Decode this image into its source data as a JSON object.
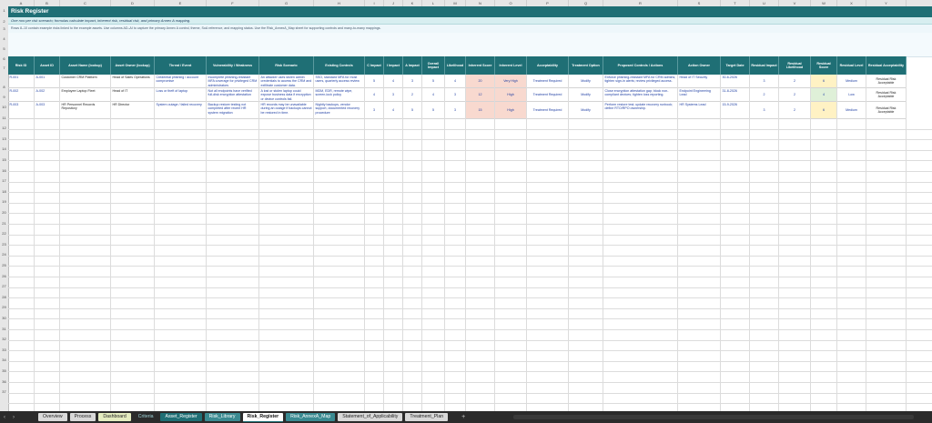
{
  "title": "Risk Register",
  "subtitle": "One row per risk scenario; formulas calculate impact, inherent risk, residual risk, and primary Annex A mapping.",
  "note": "Rows 8–10 contain example risks linked to the example assets. Use columns AD–AI to capture the primary Annex A control, theme, SoA reference, and mapping status. Use the Risk_AnnexA_Map sheet for supporting controls and many-to-many mappings.",
  "columns_letters": [
    "A",
    "B",
    "C",
    "D",
    "E",
    "F",
    "G",
    "H",
    "I",
    "J",
    "K",
    "L",
    "M",
    "N",
    "O",
    "P",
    "Q",
    "R",
    "S",
    "T",
    "U",
    "V",
    "W",
    "X",
    "Y"
  ],
  "headers": [
    "Risk ID",
    "Asset ID",
    "Asset Name (lookup)",
    "Asset Owner (lookup)",
    "Threat / Event",
    "Vulnerability / Weakness",
    "Risk Scenario",
    "Existing Controls",
    "C Impact",
    "I Impact",
    "A Impact",
    "Overall Impact",
    "Likelihood",
    "Inherent Score",
    "Inherent Level",
    "Acceptability",
    "Treatment Option",
    "Proposed Controls / Actions",
    "Action Owner",
    "Target Date",
    "Residual Impact",
    "Residual Likelihood",
    "Residual Score",
    "Residual Level",
    "Residual Acceptability"
  ],
  "rows": [
    [
      "R-001",
      "A-001",
      "Customer CRM Platform",
      "Head of Sales Operations",
      "Credential phishing / account compromise",
      "Incomplete phishing-resistant MFA coverage for privileged CRM administrators",
      "An attacker uses stolen admin credentials to access the CRM and exfiltrate customer data.",
      "SSO, standard MFA for most users, quarterly access review",
      "5",
      "4",
      "3",
      "5",
      "4",
      "20",
      "Very High",
      "Treatment Required",
      "Modify",
      "Enforce phishing-resistant MFA for CRM admins; tighten sign-in alerts; review privileged access.",
      "Head of IT Security",
      "30-6-2026",
      "3",
      "2",
      "6",
      "Medium",
      "Residual Risk Acceptable"
    ],
    [
      "R-002",
      "A-002",
      "Employee Laptop Fleet",
      "Head of IT",
      "Loss or theft of laptop",
      "Not all endpoints have verified full-disk encryption attestation",
      "A lost or stolen laptop could expose business data if encryption or device controls fail.",
      "MDM, EDR, remote wipe, screen-lock policy",
      "4",
      "3",
      "2",
      "4",
      "3",
      "12",
      "High",
      "Treatment Required",
      "Modify",
      "Close encryption attestation gap; block non-compliant devices; tighten loss reporting.",
      "Endpoint Engineering Lead",
      "31-8-2026",
      "2",
      "2",
      "4",
      "Low",
      "Residual Risk Acceptable"
    ],
    [
      "R-003",
      "A-003",
      "HR Personnel Records Repository",
      "HR Director",
      "System outage / failed recovery",
      "Backup restore testing not completed after recent HR system migration",
      "HR records may be unavailable during an outage if backups cannot be restored in time.",
      "Nightly backups, vendor support, documented recovery procedure",
      "3",
      "4",
      "5",
      "5",
      "3",
      "15",
      "High",
      "Treatment Required",
      "Modify",
      "Perform restore test; update recovery runbook; define RTO/RPO ownership.",
      "HR Systems Lead",
      "15-9-2026",
      "3",
      "2",
      "6",
      "Medium",
      "Residual Risk Acceptable"
    ]
  ],
  "row_numbers": [
    "1",
    "2",
    "3",
    "4",
    "5",
    "6",
    "7",
    "8",
    "9",
    "10",
    "11",
    "12",
    "13",
    "14",
    "15",
    "16",
    "17",
    "18",
    "19",
    "20",
    "21",
    "22",
    "23",
    "24",
    "25",
    "26",
    "27",
    "28",
    "29",
    "30",
    "31",
    "32",
    "33",
    "34",
    "35",
    "36",
    "37"
  ],
  "tabs": [
    {
      "label": "Overview",
      "style": "plain"
    },
    {
      "label": "Process",
      "style": "plain"
    },
    {
      "label": "Dashboard",
      "style": "green"
    },
    {
      "label": "Criteria",
      "style": "dark"
    },
    {
      "label": "Asset_Register",
      "style": "teal"
    },
    {
      "label": "Risk_Library",
      "style": "teal2"
    },
    {
      "label": "Risk_Register",
      "style": "active"
    },
    {
      "label": "Risk_AnnexA_Map",
      "style": "teal2"
    },
    {
      "label": "Statement_of_Applicability",
      "style": "plain"
    },
    {
      "label": "Treatment_Plan",
      "style": "plain"
    }
  ],
  "nav": {
    "prev": "‹",
    "next": "›",
    "add": "+"
  }
}
